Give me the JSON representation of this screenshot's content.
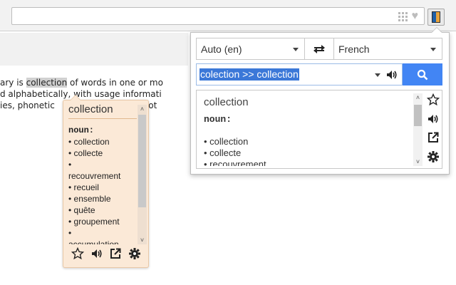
{
  "page": {
    "content_lines": [
      [
        "ary is ",
        "collection",
        " of words in one or mo"
      ],
      [
        "d alphabetically, with usage informati",
        "",
        ""
      ],
      [
        "ies, phonetic",
        "",
        ""
      ]
    ]
  },
  "popup": {
    "source_language": "Auto (en)",
    "target_language": "French",
    "input_text": "colection >> collection",
    "result": {
      "word": "collection",
      "part_of_speech": "noun:",
      "translations": [
        "• collection",
        "• collecte",
        "• recouvrement"
      ]
    }
  },
  "bubble": {
    "word": "collection",
    "part_of_speech": "noun:",
    "translations": [
      "• collection",
      "• collecte",
      "•",
      "recouvrement",
      "• recueil",
      "• ensemble",
      "• quête",
      "• groupement",
      "•",
      "accumulation"
    ],
    "trailing_text": "d ot"
  },
  "colors": {
    "accent": "#4285f4",
    "selection": "#3b78d8",
    "bubble_bg": "#fbe9d7"
  }
}
